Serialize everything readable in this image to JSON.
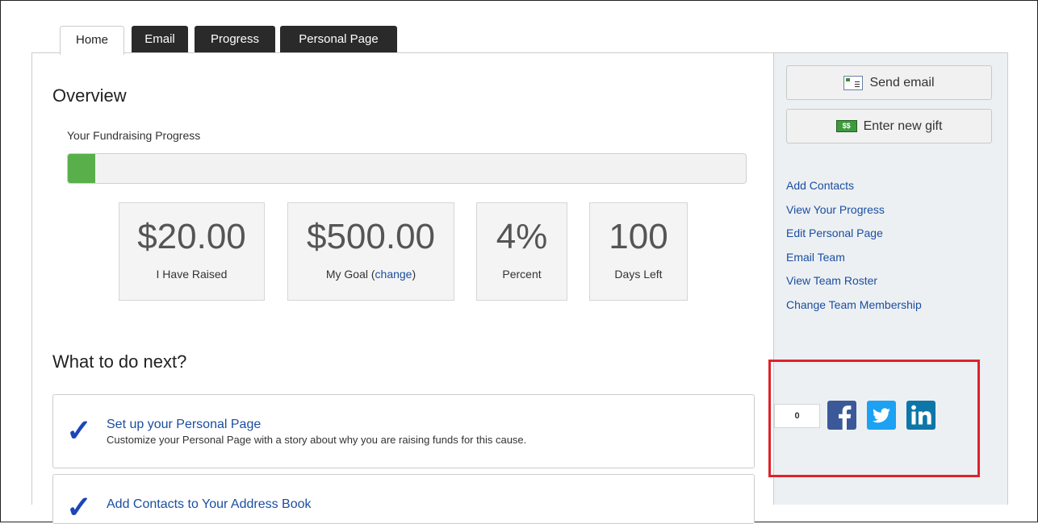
{
  "tabs": [
    {
      "label": "Home"
    },
    {
      "label": "Email"
    },
    {
      "label": "Progress"
    },
    {
      "label": "Personal Page"
    }
  ],
  "overview": {
    "title": "Overview",
    "progress_label": "Your Fundraising Progress",
    "progress_fraction": 0.04,
    "stats": [
      {
        "value": "$20.00",
        "label": "I Have Raised"
      },
      {
        "value": "$500.00",
        "label": "My Goal (",
        "link": "change",
        "suffix": ")"
      },
      {
        "value": "4%",
        "label": "Percent"
      },
      {
        "value": "100",
        "label": "Days Left"
      }
    ]
  },
  "next": {
    "title": "What to do next?",
    "items": [
      {
        "title": "Set up your Personal Page",
        "description": "Customize your Personal Page with a story about why you are raising funds for this cause."
      },
      {
        "title": "Add Contacts to Your Address Book",
        "description": ""
      }
    ]
  },
  "sidebar": {
    "send_email": "Send email",
    "enter_gift": "Enter new gift",
    "links": [
      "Add Contacts",
      "View Your Progress",
      "Edit Personal Page",
      "Email Team",
      "View Team Roster",
      "Change Team Membership"
    ],
    "share_count": "0",
    "icons": [
      "facebook-icon",
      "twitter-icon",
      "linkedin-icon"
    ]
  },
  "colors": {
    "accent_link": "#1a4ea0",
    "progress_fill": "#59b04a",
    "facebook": "#3b5998",
    "twitter": "#1da1f2",
    "linkedin": "#0e76a8",
    "highlight": "#e0212a"
  }
}
